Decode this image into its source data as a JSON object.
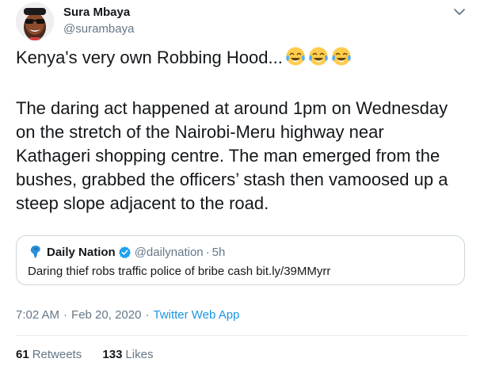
{
  "author": {
    "name": "Sura Mbaya",
    "handle": "@surambaya"
  },
  "tweet": {
    "lines": [
      "Kenya's very own Robbing Hood...",
      "",
      "The daring act happened at around 1pm on Wednesday",
      "on the stretch of the Nairobi-Meru highway near",
      "Kathageri shopping centre. The man emerged from the",
      "bushes, grabbed the officers’ stash then vamoosed up a",
      "steep slope adjacent to the road."
    ],
    "emojis": [
      "face-with-tears-of-joy",
      "face-with-tears-of-joy",
      "face-with-tears-of-joy"
    ]
  },
  "quoted_tweet": {
    "name": "Daily Nation",
    "handle": "@dailynation",
    "separator": "·",
    "time": "5h",
    "text": "Daring thief robs traffic police of bribe cash bit.ly/39MMyrr"
  },
  "meta": {
    "time": "7:02 AM",
    "date": "Feb 20, 2020",
    "dot": "·",
    "source": "Twitter Web App"
  },
  "stats": {
    "retweets_count": "61",
    "retweets_label": "Retweets",
    "likes_count": "133",
    "likes_label": "Likes"
  },
  "colors": {
    "text": "#14171a",
    "secondary": "#657786",
    "link": "#1b95e0",
    "border": "#ccd6dd",
    "verified": "#1da1f2"
  }
}
